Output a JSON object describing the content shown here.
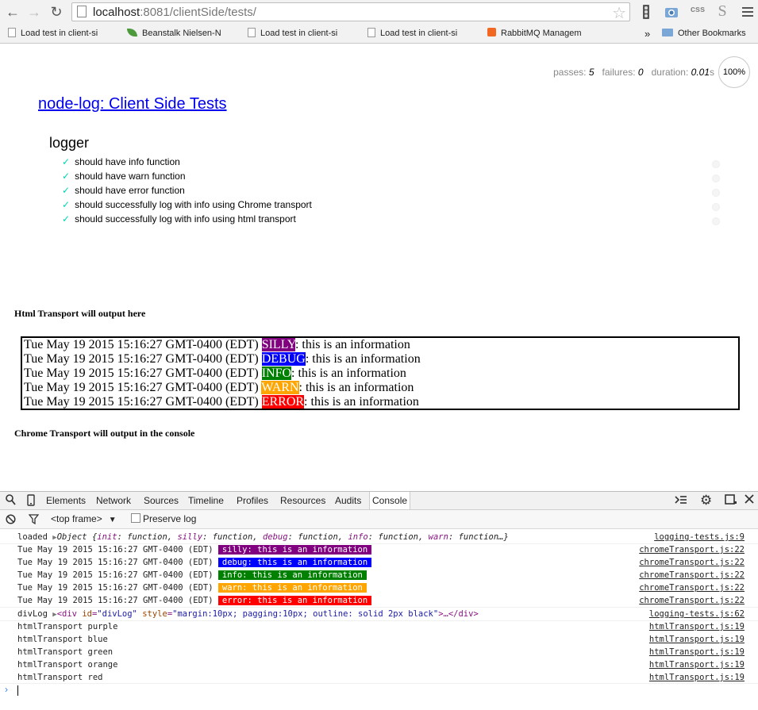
{
  "browser": {
    "url_host": "localhost",
    "url_rest": ":8081/clientSide/tests/",
    "extensions": [
      "css",
      "S"
    ],
    "bookmarks": [
      {
        "label": "Load test in client-si",
        "icon": "page"
      },
      {
        "label": "Beanstalk Nielsen-N",
        "icon": "leaf"
      },
      {
        "label": "Load test in client-si",
        "icon": "page"
      },
      {
        "label": "Load test in client-si",
        "icon": "page"
      },
      {
        "label": "RabbitMQ Managem",
        "icon": "rabbitmq"
      }
    ],
    "more_bookmarks": "»",
    "other_bookmarks": "Other Bookmarks"
  },
  "mocha": {
    "passes_label": "passes:",
    "passes": "5",
    "failures_label": "failures:",
    "failures": "0",
    "duration_label": "duration:",
    "duration": "0.01",
    "duration_unit": "s",
    "progress": "100%",
    "progress_fraction": 1.0,
    "suite_title": "node-log: Client Side Tests",
    "suite_name": "logger",
    "tests": [
      "should have info function",
      "should have warn function",
      "should have error function",
      "should successfully log with info using Chrome transport",
      "should successfully log with info using html transport"
    ],
    "check": "✓"
  },
  "page": {
    "html_heading": "Html Transport will output here",
    "timestamp": "Tue May 19 2015 15:16:27 GMT-0400 (EDT)",
    "message": ": this is an information",
    "log_levels": [
      {
        "label": "SILLY",
        "color": "#800080"
      },
      {
        "label": "DEBUG",
        "color": "#0000ff"
      },
      {
        "label": "INFO",
        "color": "#008000"
      },
      {
        "label": "WARN",
        "color": "#ffa500"
      },
      {
        "label": "ERROR",
        "color": "#ff0000"
      }
    ],
    "chrome_heading": "Chrome Transport will output in the console"
  },
  "devtools": {
    "tabs": [
      "Elements",
      "Network",
      "Sources",
      "Timeline",
      "Profiles",
      "Resources",
      "Audits",
      "Console"
    ],
    "active_tab": "Console",
    "frame": "<top frame>",
    "preserve_log": "Preserve log",
    "console": {
      "loaded_prefix": "loaded",
      "object_text": "Object {",
      "object_props": [
        {
          "key": "init",
          "val": "function"
        },
        {
          "key": "silly",
          "val": "function"
        },
        {
          "key": "debug",
          "val": "function"
        },
        {
          "key": "info",
          "val": "function"
        },
        {
          "key": "warn",
          "val": "function"
        }
      ],
      "object_tail": "…}",
      "loaded_src": "logging-tests.js:9",
      "timestamp": "Tue May 19 2015 15:16:27 GMT-0400 (EDT)",
      "chrome_lines": [
        {
          "text": "silly: this is an information",
          "color": "#800080"
        },
        {
          "text": "debug: this is an information",
          "color": "#0000ff"
        },
        {
          "text": "info: this is an information",
          "color": "#008000"
        },
        {
          "text": "warn: this is an information",
          "color": "#ffa500"
        },
        {
          "text": "error: this is an information",
          "color": "#ff0000"
        }
      ],
      "chrome_src": "chromeTransport.js:22",
      "divlog_prefix": "divLog",
      "divlog_open": "<div",
      "divlog_id_attr": "id",
      "divlog_id_val": "\"divLog\"",
      "divlog_style_attr": "style",
      "divlog_style_val": "\"margin:10px; pagging:10px; outline: solid 2px black\"",
      "divlog_close": ">…</div>",
      "divlog_src": "logging-tests.js:62",
      "html_transport": [
        "htmlTransport purple",
        "htmlTransport blue",
        "htmlTransport green",
        "htmlTransport orange",
        "htmlTransport red"
      ],
      "html_src": "htmlTransport.js:19",
      "prompt": "›"
    }
  }
}
